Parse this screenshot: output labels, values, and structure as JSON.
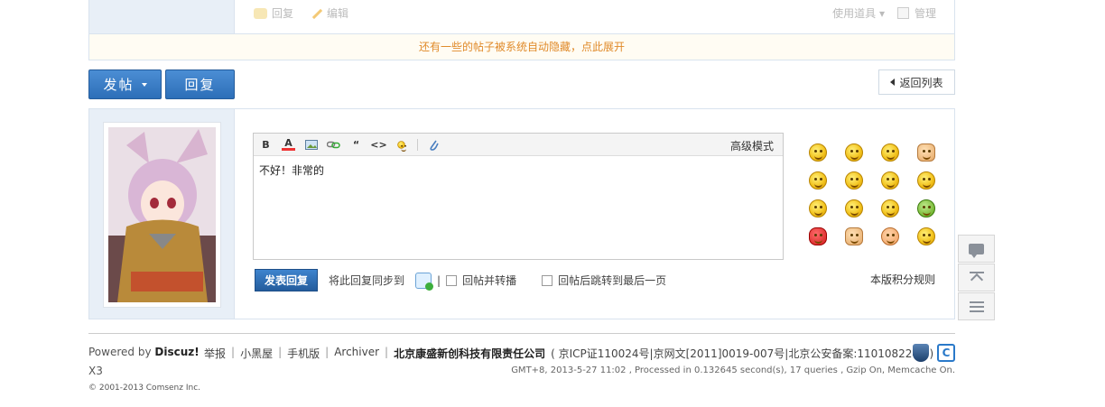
{
  "post_tail": {
    "reply_label": "回复",
    "edit_label": "编辑",
    "tools_label": "使用道具",
    "manage_label": "管理"
  },
  "hidden_notice": "还有一些的帖子被系统自动隐藏，点此展开",
  "toolbar_buttons": {
    "post_label": "发帖",
    "reply_label": "回复",
    "back_label": "返回列表"
  },
  "editor": {
    "advanced_mode": "高级模式",
    "content": "不好！非常的",
    "bold_label": "B",
    "color_label": "A",
    "quote_label": "“",
    "code_label": "<>"
  },
  "submit": {
    "button_label": "发表回复",
    "sync_label": "将此回复同步到",
    "sep": "|",
    "repost_label": "回帖并转播",
    "jump_last_label": "回帖后跳转到最后一页"
  },
  "credits_rule": "本版积分规则",
  "footer": {
    "powered_by": "Powered by ",
    "brand": "Discuz!",
    "version": "X3",
    "links": [
      "举报",
      "小黑屋",
      "手机版",
      "Archiver"
    ],
    "company": "北京康盛新创科技有限责任公司",
    "icp": "( 京ICP证110024号|京网文[2011]0019-007号|北京公安备案:1101082242 )",
    "copyright": "© 2001-2013 Comsenz Inc.",
    "stats": "GMT+8, 2013-5-27 11:02 , Processed in 0.132645 second(s), 17 queries , Gzip On, Memcache On.",
    "cnzz_letter": "C"
  },
  "colors": {
    "primary_blue": "#2d6fb8",
    "notice_orange": "#e08a2a",
    "panel_bg": "#e8eff7"
  }
}
